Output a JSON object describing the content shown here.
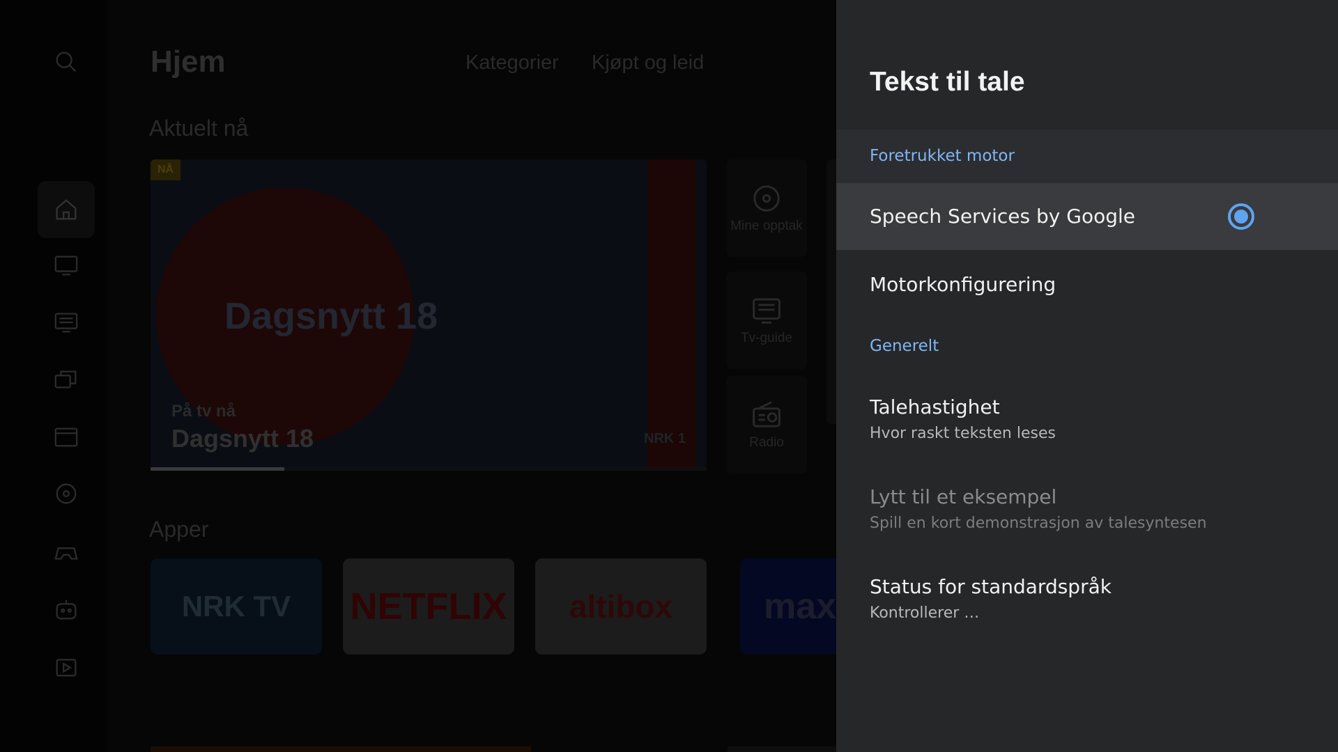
{
  "home": {
    "title": "Hjem",
    "tabs": [
      "Kategorier",
      "Kjøpt og leid"
    ],
    "section_now": "Aktuelt nå",
    "section_apps": "Apper",
    "hero": {
      "now_badge": "NÅ",
      "logo_text": "Dagsnytt 18",
      "subtitle": "På tv nå",
      "title": "Dagsnytt 18",
      "channel": "NRK 1",
      "progress": 0.24
    },
    "side_tiles": [
      "Mine opptak",
      "Tv-guide",
      "Radio"
    ],
    "apps": [
      "NRK TV",
      "NETFLIX",
      "altibox",
      "max"
    ]
  },
  "rail": {
    "icons": [
      "search-icon",
      "home-icon",
      "tv-icon",
      "tv-guide-icon",
      "library-icon",
      "movies-icon",
      "recordings-icon",
      "games-icon",
      "kids-icon",
      "apps-icon"
    ]
  },
  "panel": {
    "title": "Tekst til tale",
    "header_engine": "Foretrukket motor",
    "engine_option": "Speech Services by Google",
    "engine_config": "Motorkonfigurering",
    "header_general": "Generelt",
    "speech_rate": {
      "title": "Talehastighet",
      "subtitle": "Hvor raskt teksten leses"
    },
    "listen_example": {
      "title": "Lytt til et eksempel",
      "subtitle": "Spill en kort demonstrasjon av talesyntesen"
    },
    "language_status": {
      "title": "Status for standardspråk",
      "subtitle": "Kontrollerer …"
    }
  },
  "colors": {
    "panel_bg": "#262729",
    "accent": "#5ea4f2",
    "header_text": "#7fb6f5",
    "selected_row": "#3a3b3e"
  }
}
